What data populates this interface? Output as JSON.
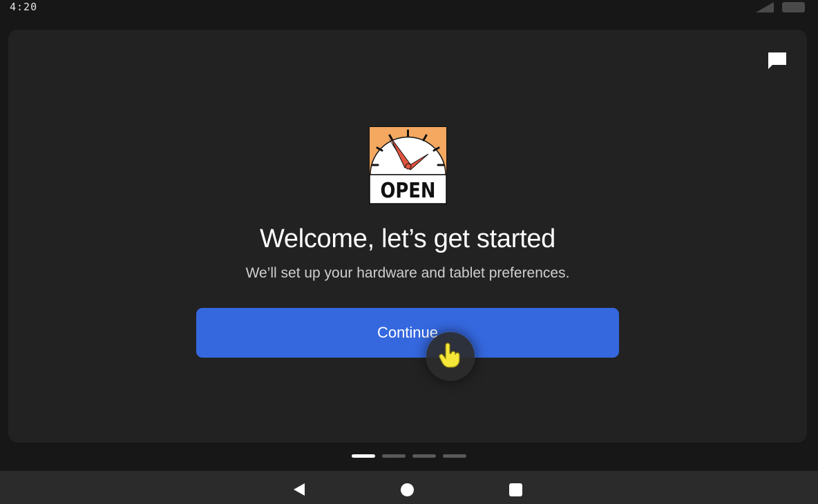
{
  "status_bar": {
    "time": "4:20"
  },
  "logo": {
    "text": "OPEN"
  },
  "welcome": {
    "title": "Welcome, let’s get started",
    "subtitle": "We’ll set up your hardware and tablet preferences.",
    "continue_label": "Continue"
  },
  "pager": {
    "count": 4,
    "active_index": 0
  },
  "icons": {
    "feedback": "chat-bubble-icon",
    "touch": "pointing-hand-icon",
    "back": "back-triangle-icon",
    "home": "home-circle-icon",
    "recents": "recents-square-icon"
  },
  "colors": {
    "accent": "#3568df",
    "card_background": "#222222",
    "logo_orange": "#f4a860",
    "touch_yellow": "#f5e63a"
  }
}
